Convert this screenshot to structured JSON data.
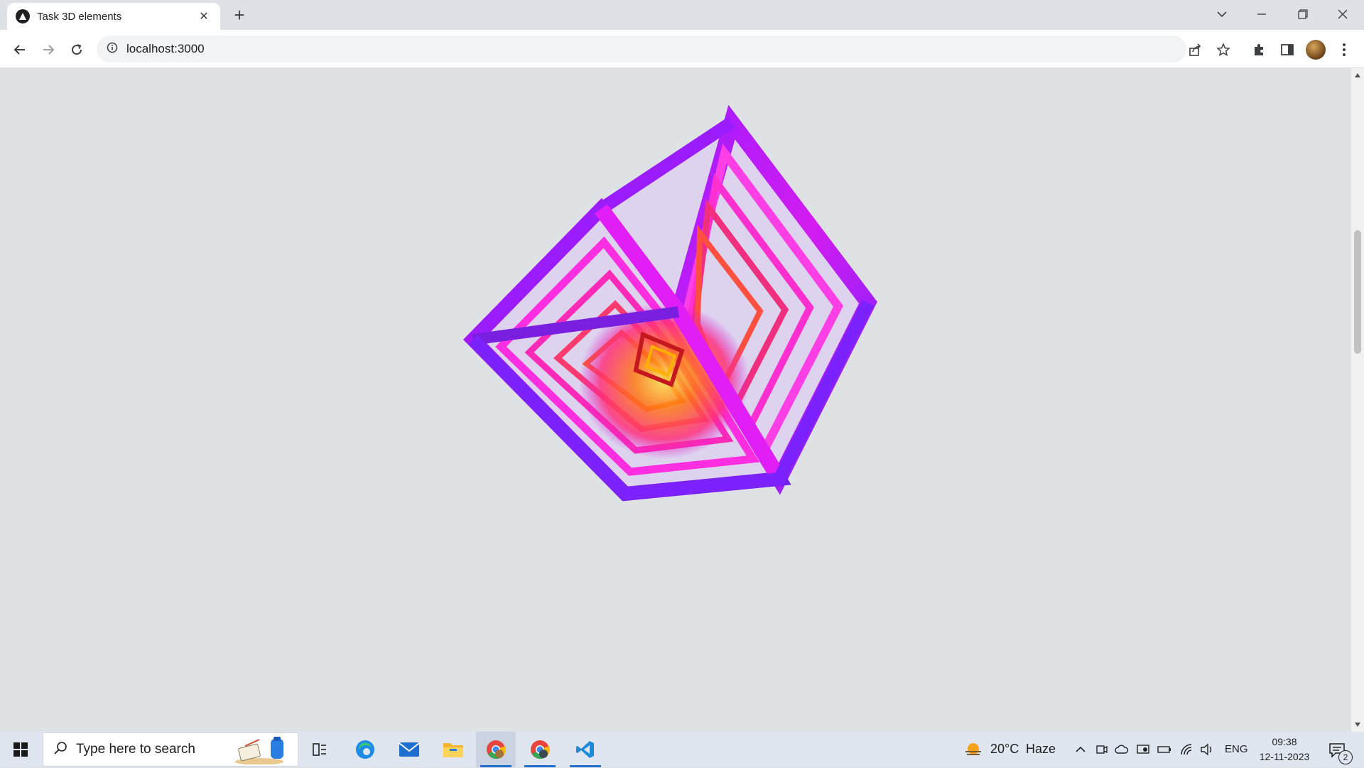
{
  "browser": {
    "tab": {
      "title": "Task 3D elements"
    },
    "address_bar": {
      "url": "localhost:3000"
    }
  },
  "page": {
    "scene": "3D wireframe cube with nested magenta-purple-orange frames"
  },
  "taskbar": {
    "search_placeholder": "Type here to search",
    "weather": {
      "temperature": "20°C",
      "condition": "Haze"
    },
    "language": "ENG",
    "clock": {
      "time": "09:38",
      "date": "12-11-2023"
    },
    "notifications_count": "2"
  },
  "colors": {
    "cube_outer": "#8a2be2",
    "cube_inner": "#ff2fd4",
    "cube_core": "#ff6a00",
    "page_background": "#dfe2e5",
    "taskbar_background": "#dfe6f0"
  }
}
